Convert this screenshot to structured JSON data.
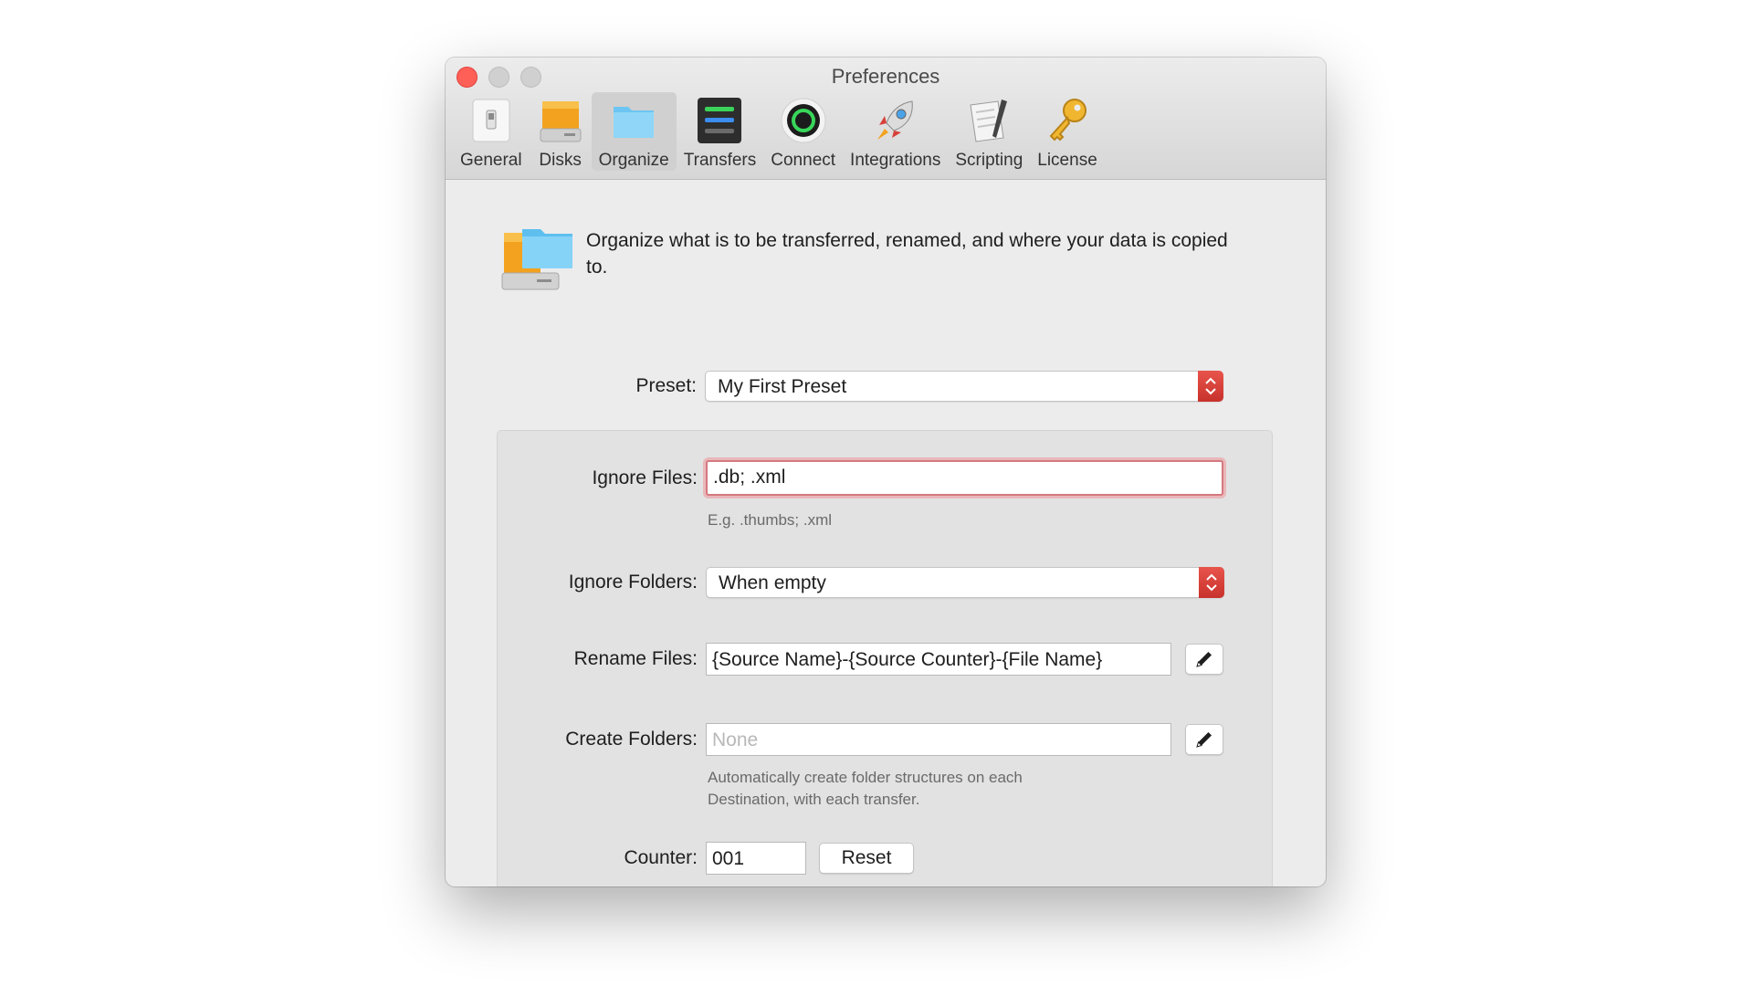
{
  "window": {
    "title": "Preferences"
  },
  "toolbar": {
    "items": [
      {
        "label": "General",
        "icon": "light-switch-icon"
      },
      {
        "label": "Disks",
        "icon": "hard-disk-icon"
      },
      {
        "label": "Organize",
        "icon": "folder-icon",
        "selected": true
      },
      {
        "label": "Transfers",
        "icon": "transfers-icon"
      },
      {
        "label": "Connect",
        "icon": "connect-ring-icon"
      },
      {
        "label": "Integrations",
        "icon": "rocket-icon"
      },
      {
        "label": "Scripting",
        "icon": "script-pen-icon"
      },
      {
        "label": "License",
        "icon": "key-icon"
      }
    ]
  },
  "intro": {
    "text": "Organize what is to be transferred, renamed, and where your data is copied to."
  },
  "preset": {
    "label": "Preset:",
    "value": "My First Preset"
  },
  "ignore_files": {
    "label": "Ignore Files:",
    "value": ".db; .xml",
    "hint": "E.g. .thumbs; .xml"
  },
  "ignore_folders": {
    "label": "Ignore Folders:",
    "value": "When empty"
  },
  "rename_files": {
    "label": "Rename Files:",
    "value": "{Source Name}-{Source Counter}-{File Name}"
  },
  "create_folders": {
    "label": "Create Folders:",
    "placeholder": "None",
    "hint": "Automatically create folder structures on each Destination, with each transfer."
  },
  "counter": {
    "label": "Counter:",
    "value": "001",
    "reset_label": "Reset"
  },
  "colors": {
    "accent_red": "#d8403a",
    "focus_ring": "#d5797f",
    "close_button": "#fe5f57"
  }
}
